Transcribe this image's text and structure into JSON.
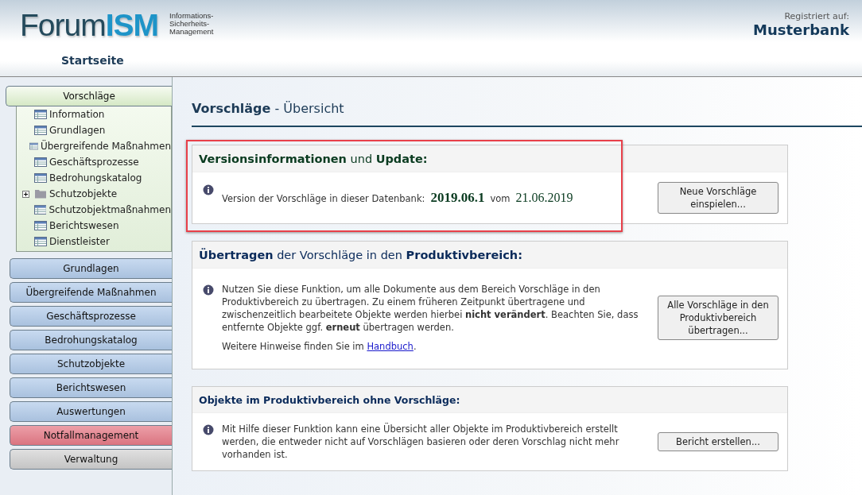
{
  "header": {
    "logo_dark": "Forum",
    "logo_accent": "ISM",
    "tagline": [
      "Informations-",
      "Sicherheits-",
      "Management"
    ],
    "registered_label": "Registriert auf:",
    "registered_name": "Musterbank",
    "home_link": "Startseite"
  },
  "sidebar": {
    "sections": [
      {
        "label": "Vorschläge",
        "kind": "green",
        "expanded": true,
        "children": [
          {
            "label": "Information",
            "kind": "page"
          },
          {
            "label": "Grundlagen",
            "kind": "page"
          },
          {
            "label": "Übergreifende Maßnahmen",
            "kind": "page"
          },
          {
            "label": "Geschäftsprozesse",
            "kind": "page"
          },
          {
            "label": "Bedrohungskatalog",
            "kind": "page"
          },
          {
            "label": "Schutzobjekte",
            "kind": "folder",
            "expanded": false
          },
          {
            "label": "Schutzobjektmaßnahmen",
            "kind": "page"
          },
          {
            "label": "Berichtswesen",
            "kind": "page"
          },
          {
            "label": "Dienstleister",
            "kind": "page"
          }
        ]
      },
      {
        "label": "Grundlagen",
        "kind": "blue",
        "expanded": false
      },
      {
        "label": "Übergreifende Maßnahmen",
        "kind": "blue",
        "expanded": false
      },
      {
        "label": "Geschäftsprozesse",
        "kind": "blue",
        "expanded": false
      },
      {
        "label": "Bedrohungskatalog",
        "kind": "blue",
        "expanded": false
      },
      {
        "label": "Schutzobjekte",
        "kind": "blue",
        "expanded": false
      },
      {
        "label": "Berichtswesen",
        "kind": "blue",
        "expanded": false
      },
      {
        "label": "Auswertungen",
        "kind": "blue",
        "expanded": false
      },
      {
        "label": "Notfallmanagement",
        "kind": "red",
        "expanded": false
      },
      {
        "label": "Verwaltung",
        "kind": "grey",
        "expanded": false
      }
    ]
  },
  "page_title": {
    "main": "Vorschläge",
    "sub": "- Übersicht"
  },
  "panels": [
    {
      "kind": "version",
      "title": "**Versionsinformationen** und **Update:**",
      "title_bold": false,
      "highlighted": true,
      "label": "Version der Vorschläge in dieser Datenbank:",
      "version": "2019.06.1",
      "date_label": "vom",
      "date": "21.06.2019",
      "button": "Neue Vorschläge einspielen..."
    },
    {
      "kind": "text",
      "title": "**Übertragen** der Vorschläge in den **Produktivbereich:**",
      "title_bold": false,
      "highlighted": false,
      "paragraph": "Nutzen Sie diese Funktion, um alle Dokumente aus dem Bereich Vorschläge in den Produktivbereich zu übertragen. Zu einem früheren Zeitpunkt übertragene und zwischenzeitlich bearbeitete Objekte werden hierbei **nicht verändert**. Beachten Sie, dass entfernte Objekte ggf. **erneut** übertragen werden.",
      "hint": {
        "before": "Weitere Hinweise finden Sie im",
        "link": "Handbuch",
        "after": "."
      },
      "button": "Alle Vorschläge in den Produktivbereich übertragen..."
    },
    {
      "kind": "text",
      "title": "Objekte im Produktivbereich ohne Vorschläge:",
      "title_bold": true,
      "highlighted": false,
      "paragraph": "Mit Hilfe dieser Funktion kann eine Übersicht aller Objekte im Produktivbereich erstellt werden, die entweder nicht auf Vorschlägen basieren oder deren Vorschlag nicht mehr vorhanden ist.",
      "button": "Bericht erstellen..."
    }
  ]
}
